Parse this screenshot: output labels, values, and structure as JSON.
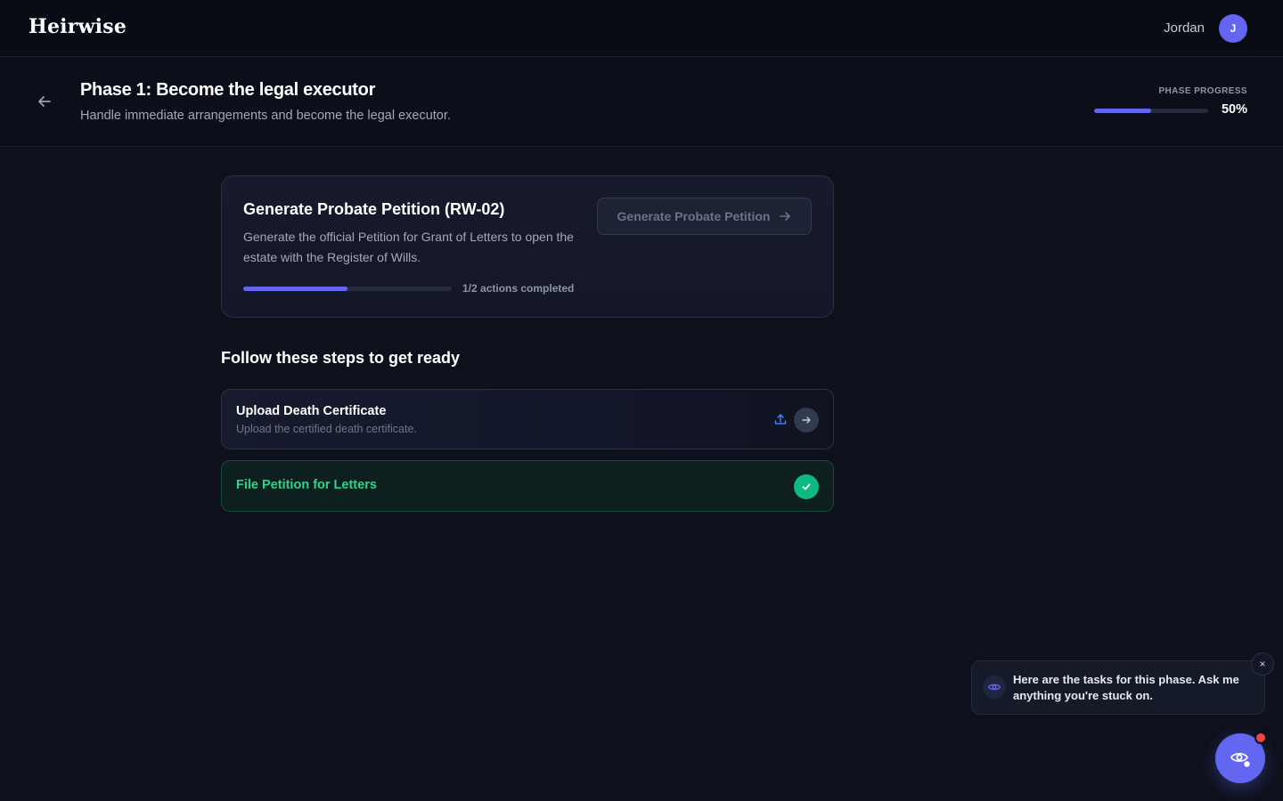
{
  "app": {
    "logo": "Heirwise",
    "user_name": "Jordan",
    "avatar_initial": "J"
  },
  "phase": {
    "title": "Phase 1: Become the legal executor",
    "subtitle": "Handle immediate arrangements and become the legal executor.",
    "progress_label": "PHASE PROGRESS",
    "progress_value": "50%",
    "progress_fraction": 0.5
  },
  "card": {
    "title": "Generate Probate Petition (RW-02)",
    "description": "Generate the official Petition for Grant of Letters to open the estate with the Register of Wills.",
    "button_label": "Generate Probate Petition",
    "actions_text": "1/2 actions completed",
    "actions_fraction": 0.5
  },
  "steps": {
    "heading": "Follow these steps to get ready",
    "items": [
      {
        "title": "Upload Death Certificate",
        "subtitle": "Upload the certified death certificate.",
        "status": "pending"
      },
      {
        "title": "File Petition for Letters",
        "status": "completed"
      }
    ]
  },
  "assistant": {
    "message": "Here are the tasks for this phase. Ask me anything you're stuck on.",
    "close_glyph": "×"
  },
  "colors": {
    "accent": "#6366f1",
    "success": "#10b981",
    "notification": "#ef4444"
  }
}
